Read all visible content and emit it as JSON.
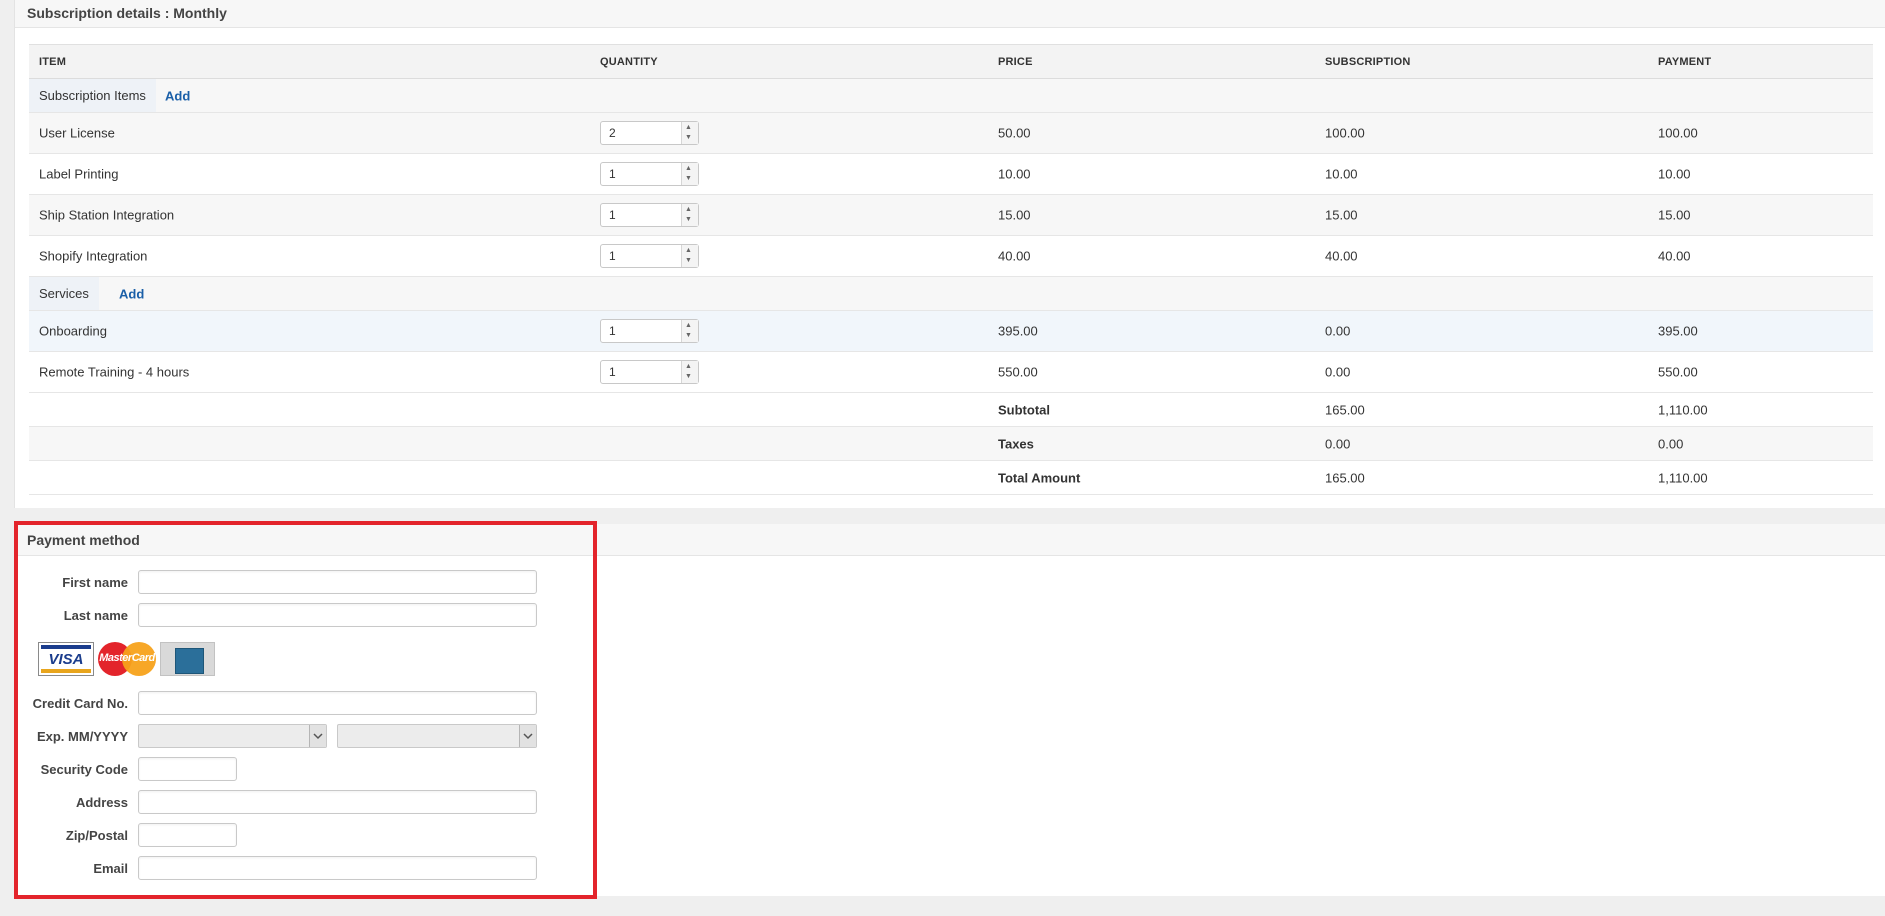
{
  "subscription": {
    "title": "Subscription details : Monthly",
    "headers": [
      "ITEM",
      "QUANTITY",
      "PRICE",
      "SUBSCRIPTION",
      "PAYMENT"
    ],
    "groups": [
      {
        "label": "Subscription Items",
        "add_label": "Add",
        "items": [
          {
            "name": "User License",
            "qty": "2",
            "price": "50.00",
            "subscription": "100.00",
            "payment": "100.00"
          },
          {
            "name": "Label Printing",
            "qty": "1",
            "price": "10.00",
            "subscription": "10.00",
            "payment": "10.00"
          },
          {
            "name": "Ship Station Integration",
            "qty": "1",
            "price": "15.00",
            "subscription": "15.00",
            "payment": "15.00"
          },
          {
            "name": "Shopify Integration",
            "qty": "1",
            "price": "40.00",
            "subscription": "40.00",
            "payment": "40.00"
          }
        ]
      },
      {
        "label": "Services",
        "add_label": "Add",
        "items": [
          {
            "name": "Onboarding",
            "qty": "1",
            "price": "395.00",
            "subscription": "0.00",
            "payment": "395.00"
          },
          {
            "name": "Remote Training - 4 hours",
            "qty": "1",
            "price": "550.00",
            "subscription": "0.00",
            "payment": "550.00"
          }
        ]
      }
    ],
    "totals": [
      {
        "label": "Subtotal",
        "subscription": "165.00",
        "payment": "1,110.00"
      },
      {
        "label": "Taxes",
        "subscription": "0.00",
        "payment": "0.00"
      },
      {
        "label": "Total Amount",
        "subscription": "165.00",
        "payment": "1,110.00"
      }
    ]
  },
  "payment": {
    "title": "Payment method",
    "fields": {
      "first_name": {
        "label": "First name",
        "value": ""
      },
      "last_name": {
        "label": "Last name",
        "value": ""
      },
      "card_no": {
        "label": "Credit Card No.",
        "value": ""
      },
      "exp": {
        "label": "Exp. MM/YYYY",
        "month": "",
        "year": ""
      },
      "security_code": {
        "label": "Security Code",
        "value": ""
      },
      "address": {
        "label": "Address",
        "value": ""
      },
      "zip": {
        "label": "Zip/Postal",
        "value": ""
      },
      "email": {
        "label": "Email",
        "value": ""
      }
    },
    "cards": [
      {
        "name": "visa",
        "text": "VISA",
        "color": "#1a3c8c"
      },
      {
        "name": "mastercard",
        "text": "MasterCard",
        "color": "#e8791d"
      },
      {
        "name": "amex",
        "text": "",
        "color": "#2b6f9a"
      }
    ]
  },
  "colors": {
    "highlight_border": "#e3242b",
    "link": "#1a5fa8"
  }
}
